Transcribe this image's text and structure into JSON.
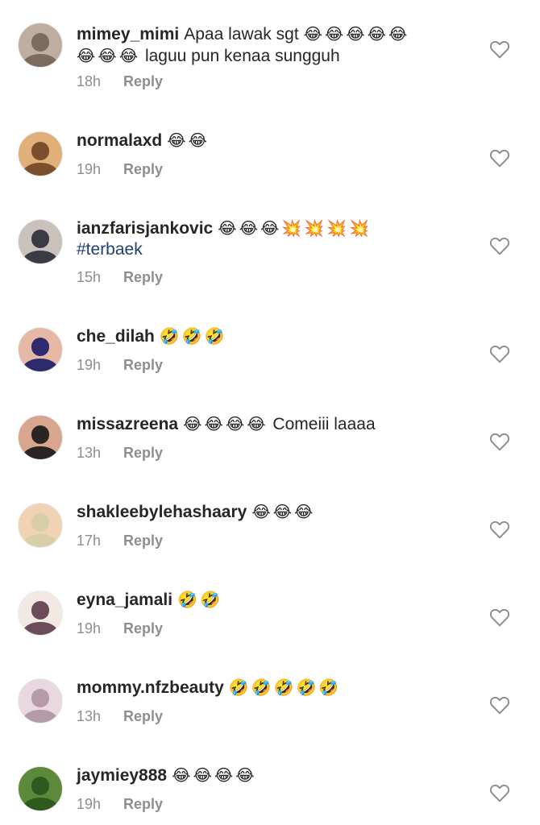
{
  "icons": {
    "avatar": "avatar-photo",
    "like": "heart-outline-icon"
  },
  "colors": {
    "text": "#262626",
    "muted": "#8e8e8e",
    "hashtag": "#1f3f73"
  },
  "comments": [
    {
      "username": "mimey_mimi",
      "text": "Apaa lawak sgt",
      "emoji": "😂😂😂😂😂😂😂😂",
      "text2": "laguu pun kenaa sungguh",
      "time": "18h",
      "reply": "Reply",
      "avatar_colors": [
        "#bfae9f",
        "#7d6a5e"
      ]
    },
    {
      "username": "normalaxd",
      "text": "",
      "emoji": "😂😂",
      "time": "19h",
      "reply": "Reply",
      "avatar_colors": [
        "#e1b07a",
        "#7b4f2c"
      ]
    },
    {
      "username": "ianzfarisjankovic",
      "text": "",
      "emoji": "😂😂😂💥💥💥💥",
      "hashtag": "#terbaek",
      "time": "15h",
      "reply": "Reply",
      "avatar_colors": [
        "#c9c2bc",
        "#3b3b45"
      ]
    },
    {
      "username": "che_dilah",
      "text": "",
      "emoji": "🤣🤣🤣",
      "time": "19h",
      "reply": "Reply",
      "avatar_colors": [
        "#e6b8a6",
        "#2d2a6e"
      ]
    },
    {
      "username": "missazreena",
      "text2": "Comeiii laaaa",
      "emoji": "😂😂😂😂",
      "time": "13h",
      "reply": "Reply",
      "avatar_colors": [
        "#d8a58e",
        "#2b2424"
      ]
    },
    {
      "username": "shakleebylehashaary",
      "text": "",
      "emoji": "😂😂😂",
      "time": "17h",
      "reply": "Reply",
      "avatar_colors": [
        "#f0d3b5",
        "#d9cfa6"
      ]
    },
    {
      "username": "eyna_jamali",
      "text": "",
      "emoji": "🤣🤣",
      "time": "19h",
      "reply": "Reply",
      "avatar_colors": [
        "#f2e8e4",
        "#6c4b5a"
      ]
    },
    {
      "username": "mommy.nfzbeauty",
      "text": "",
      "emoji": "🤣🤣🤣🤣🤣",
      "time": "13h",
      "reply": "Reply",
      "avatar_colors": [
        "#e9d8df",
        "#b59aa8"
      ]
    },
    {
      "username": "jaymiey888",
      "text": "",
      "emoji": "😂😂😂😂",
      "time": "19h",
      "reply": "Reply",
      "avatar_colors": [
        "#5c8a3a",
        "#2f5a1f"
      ]
    }
  ]
}
